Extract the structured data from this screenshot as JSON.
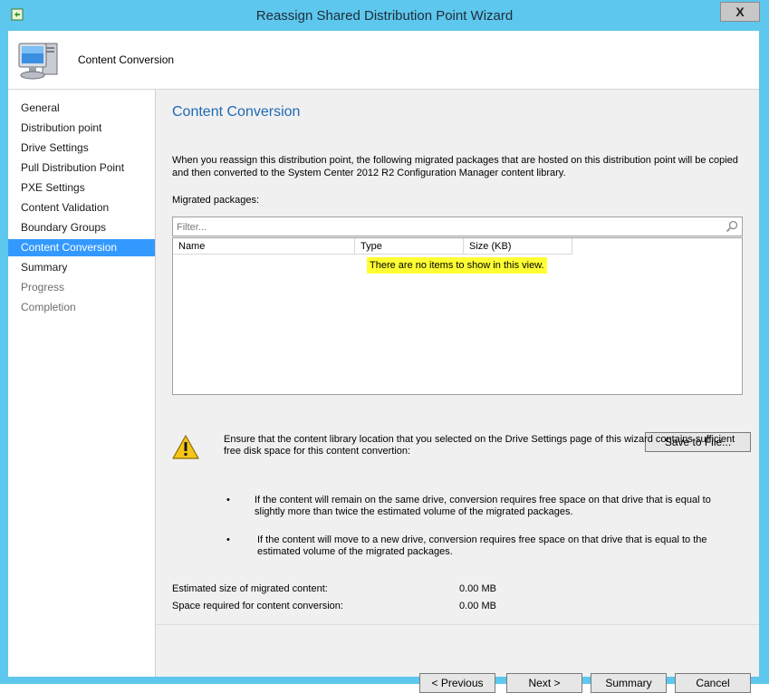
{
  "window": {
    "title": "Reassign Shared Distribution Point Wizard",
    "close_label": "X"
  },
  "header": {
    "title": "Content Conversion"
  },
  "sidebar": {
    "items": [
      {
        "label": "General",
        "state": "normal"
      },
      {
        "label": "Distribution point",
        "state": "normal"
      },
      {
        "label": "Drive Settings",
        "state": "normal"
      },
      {
        "label": "Pull Distribution Point",
        "state": "normal"
      },
      {
        "label": "PXE Settings",
        "state": "normal"
      },
      {
        "label": "Content Validation",
        "state": "normal"
      },
      {
        "label": "Boundary Groups",
        "state": "normal"
      },
      {
        "label": "Content Conversion",
        "state": "active"
      },
      {
        "label": "Summary",
        "state": "normal"
      },
      {
        "label": "Progress",
        "state": "disabled"
      },
      {
        "label": "Completion",
        "state": "disabled"
      }
    ]
  },
  "main": {
    "heading": "Content Conversion",
    "description": "When you reassign this distribution point, the following migrated packages that are hosted on this distribution point will be copied and then converted to the System Center 2012 R2 Configuration Manager content library.",
    "migrated_label": "Migrated packages:",
    "filter_placeholder": "Filter...",
    "table": {
      "columns": [
        "Name",
        "Type",
        "Size (KB)"
      ],
      "rows": [],
      "empty_message": "There are no items to show in this view."
    },
    "save_button": "Save to File...",
    "warning": {
      "text": "Ensure that the content library location that you selected on the Drive Settings page of this wizard contains sufficient free disk space for this content convertion:",
      "bullets": [
        "If the content will remain on the same drive, conversion requires free space on that drive that is equal to slightly more than twice the estimated volume of the migrated packages.",
        "If the content will move to a new drive, conversion requires free space on that drive that is equal to the estimated volume of the migrated packages."
      ]
    },
    "stats": [
      {
        "label": "Estimated size of migrated content:",
        "value": "0.00 MB"
      },
      {
        "label": "Space required for content conversion:",
        "value": "0.00 MB"
      }
    ]
  },
  "footer": {
    "previous": "< Previous",
    "next": "Next >",
    "summary": "Summary",
    "cancel": "Cancel"
  },
  "colors": {
    "title_bar": "#5ec7ed",
    "active_nav": "#3399ff",
    "heading": "#1f69b4",
    "highlight": "#ffff33"
  }
}
